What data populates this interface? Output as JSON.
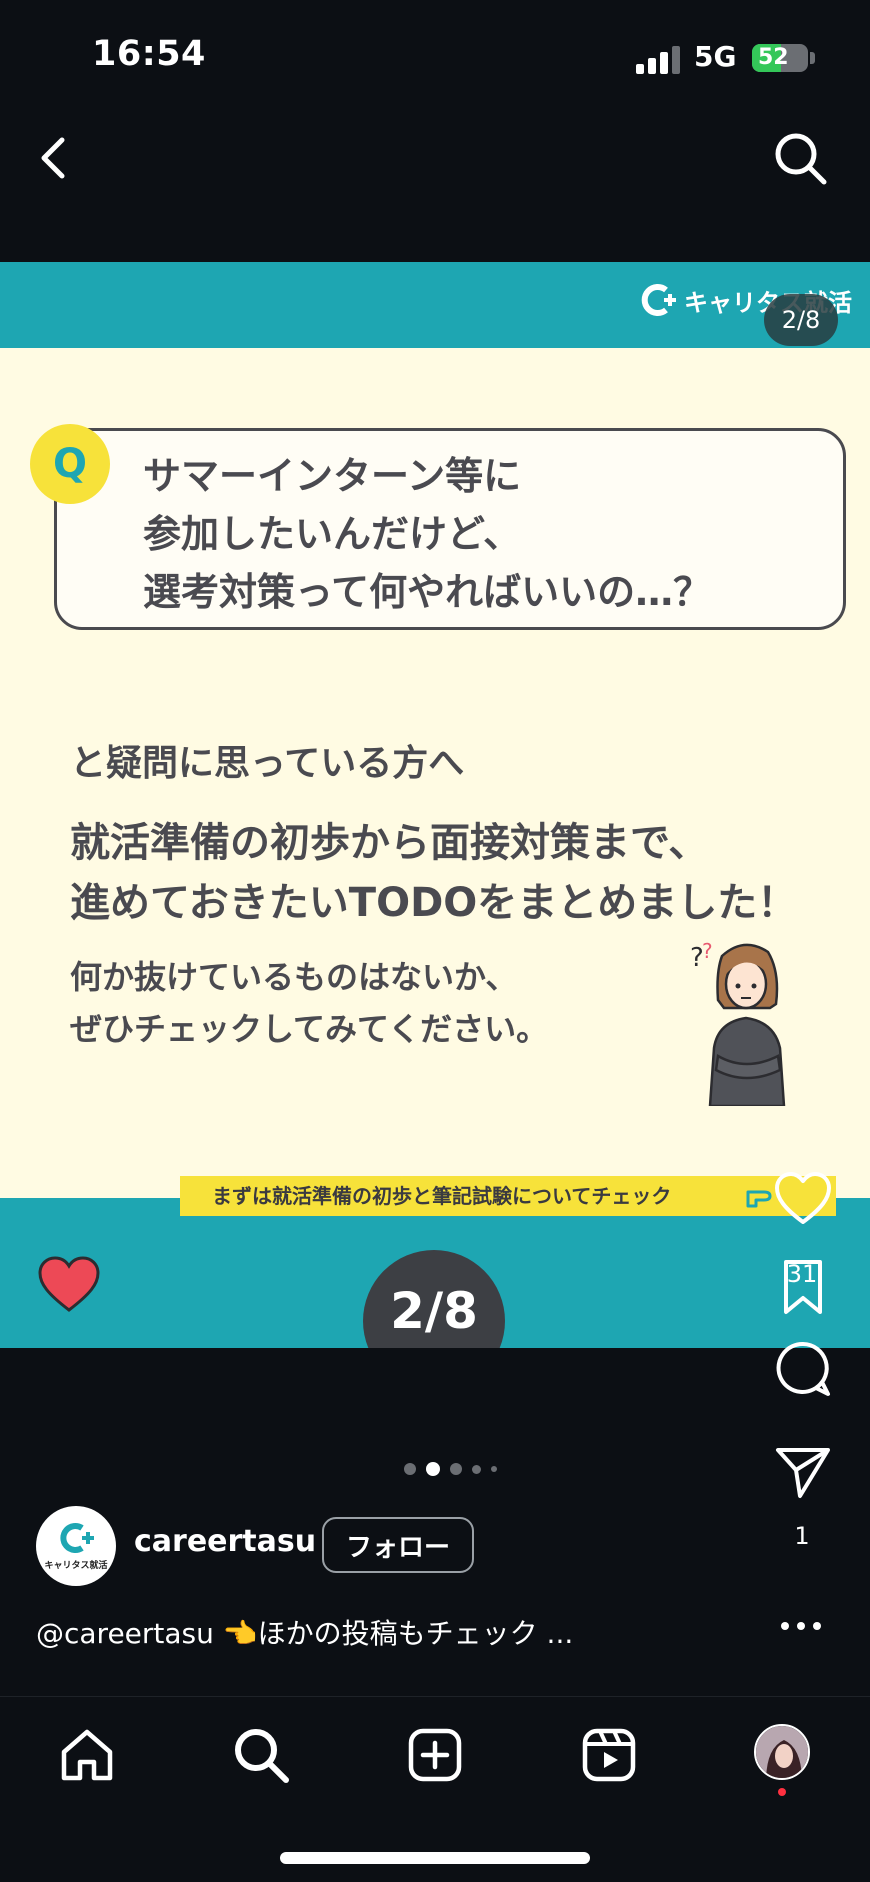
{
  "status_bar": {
    "time": "16:54",
    "network": "5G",
    "battery": "52",
    "battery_level": 0.52
  },
  "post": {
    "brand": "キャリタス就活",
    "counter": "2/8",
    "question_badge": "Q",
    "question_lines": [
      "サマーインターン等に",
      "参加したいんだけど、",
      "選考対策って何やればいいの…？"
    ],
    "lead": "と疑問に思っている方へ",
    "headline_lines": [
      "就活準備の初歩から面接対策まで、",
      "進めておきたいTODOをまとめました！"
    ],
    "sub_lines": [
      "何か抜けているものはないか、",
      "ぜひチェックしてみてください。"
    ],
    "strip_text": "まずは就活準備の初歩と筆記試験についてチェック",
    "page_bubble": "2/8"
  },
  "actions": {
    "like_count": "31",
    "share_count": "1"
  },
  "carousel": {
    "total_dots": 5,
    "active_index": 1
  },
  "account": {
    "username": "careertasu",
    "follow_label": "フォロー",
    "avatar_text": "キャリタス就活"
  },
  "caption": "@careertasu 👈ほかの投稿もチェック ...",
  "colors": {
    "teal": "#1ea6b2",
    "cream": "#fffbe3",
    "yellow": "#f7e23a",
    "heart": "#ed4956"
  }
}
